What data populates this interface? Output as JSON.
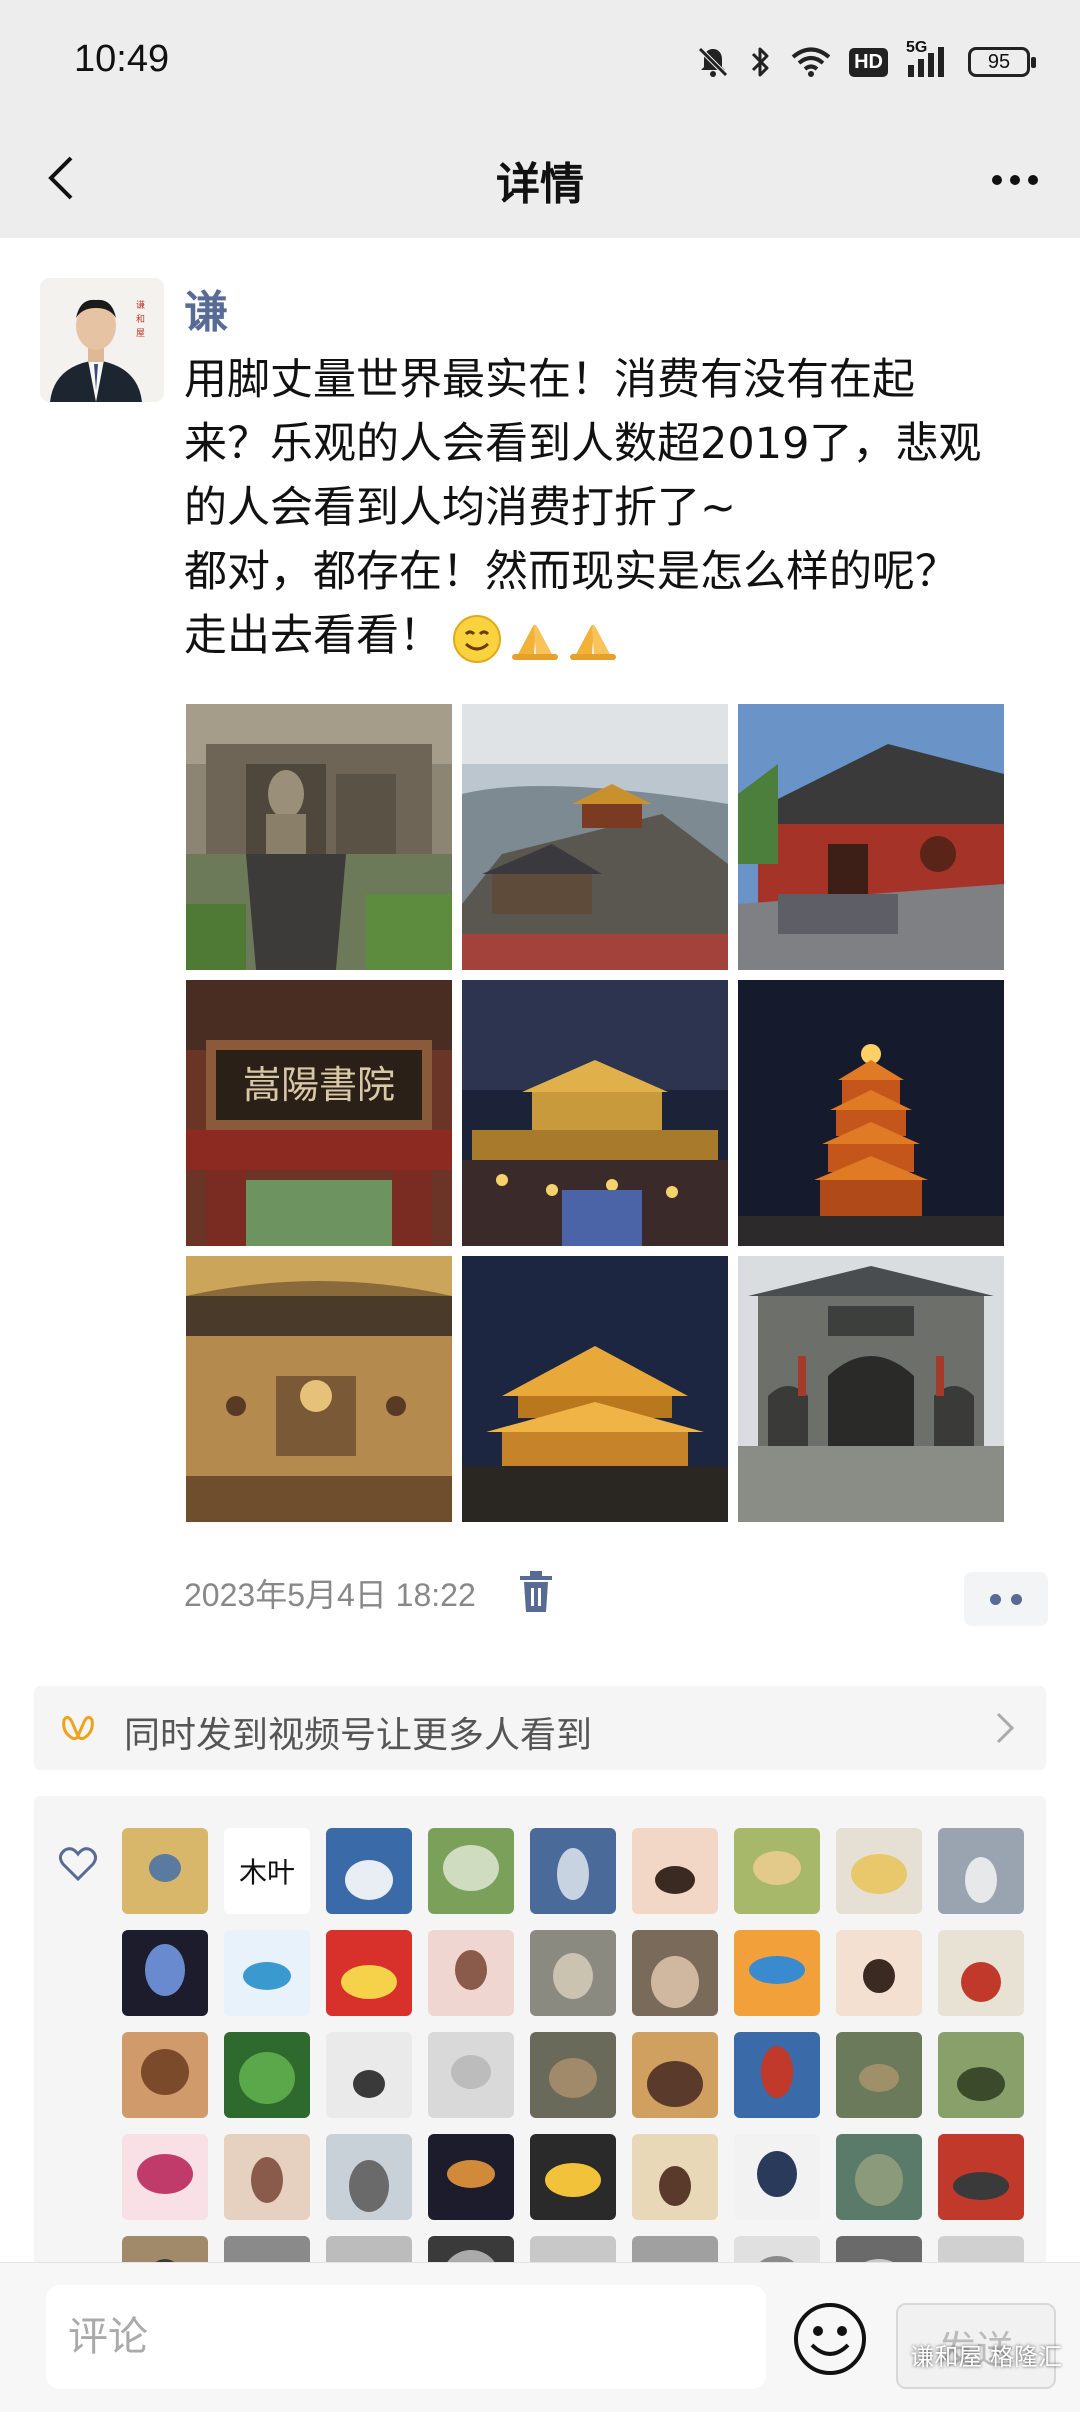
{
  "status_bar": {
    "time": "10:49",
    "hd_label": "HD",
    "signal_label": "5G",
    "battery": "95",
    "icons": [
      "mute-bell-icon",
      "bluetooth-icon",
      "wifi-icon",
      "hd-icon",
      "signal-5g-icon",
      "battery-icon"
    ]
  },
  "nav": {
    "title": "详情",
    "back_icon": "chevron-left-icon",
    "more_icon": "more-dots-icon"
  },
  "post": {
    "author": "谦",
    "lines": [
      "用脚丈量世界最实在！消费有没有在起",
      "来？乐观的人会看到人数超2019了，悲观",
      "的人会看到人均消费打折了~",
      "都对，都存在！然而现实是怎么样的呢？",
      "走出去看看！"
    ],
    "emojis": [
      "smile-emoji",
      "pray-emoji",
      "pray-emoji"
    ],
    "photos": [
      "longmen-grottoes-photo",
      "mountain-temple-photo",
      "red-temple-gate-photo",
      "songyang-academy-plaque-photo",
      "night-palace-crowd-photo",
      "night-pagoda-photo",
      "mural-hall-photo",
      "night-golden-hall-photo",
      "shaolin-gate-photo"
    ],
    "plaque_text": "嵩陽書院",
    "timestamp": "2023年5月4日 18:22"
  },
  "channels": {
    "text": "同时发到视频号让更多人看到"
  },
  "likes": {
    "avatar_count": 45,
    "brand_avatar_text": "木叶"
  },
  "bottom": {
    "comment_placeholder": "评论",
    "send_label": "发送",
    "watermark": "谦和屋 格隆汇"
  }
}
